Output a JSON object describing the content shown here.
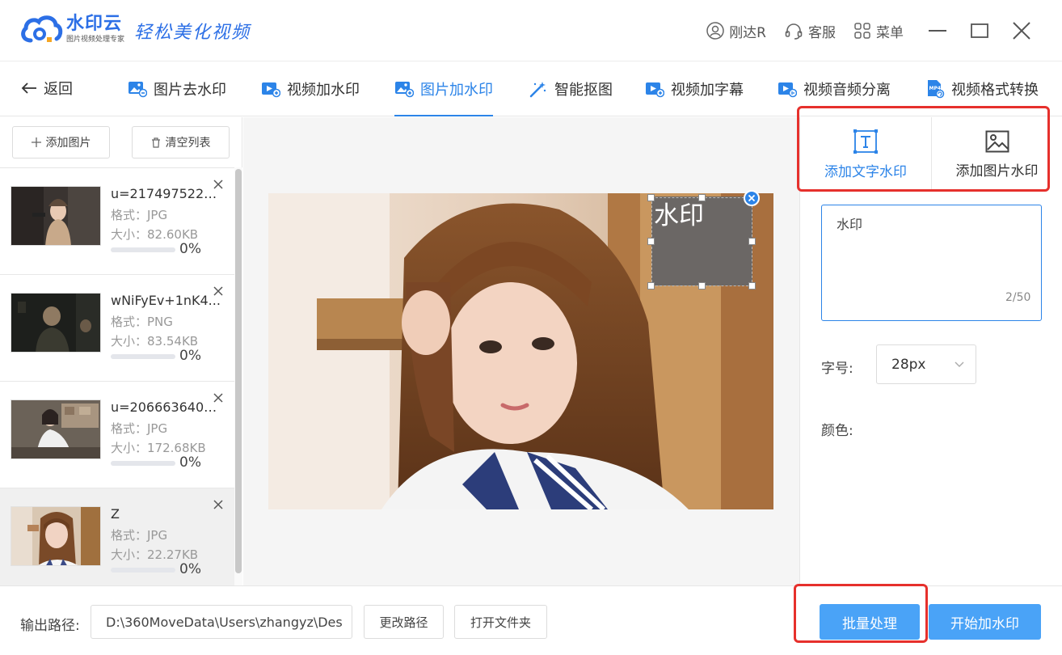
{
  "app": {
    "name": "水印云",
    "tagline": "图片视频处理专家",
    "slogan": "轻松美化视频",
    "accent_color": "#2c84e8",
    "highlight_color": "#e6302c"
  },
  "titlebar": {
    "user_label": "刚达R",
    "user_icon": "user-icon",
    "service_label": "客服",
    "service_icon": "headset-icon",
    "menu_label": "菜单",
    "menu_icon": "grid-icon",
    "window_controls": [
      "minimize-icon",
      "maximize-icon",
      "close-icon"
    ]
  },
  "toolnav": {
    "back_label": "返回",
    "tools": [
      {
        "label": "图片去水印",
        "icon": "image-remove-icon"
      },
      {
        "label": "视频加水印",
        "icon": "video-add-icon"
      },
      {
        "label": "图片加水印",
        "icon": "image-add-icon",
        "active": true
      },
      {
        "label": "智能抠图",
        "icon": "magic-wand-icon"
      },
      {
        "label": "视频加字幕",
        "icon": "video-subtitle-icon"
      },
      {
        "label": "视频音频分离",
        "icon": "video-audio-icon"
      },
      {
        "label": "视频格式转换",
        "icon": "mp4-convert-icon"
      }
    ]
  },
  "leftpanel": {
    "add_button": "添加图片",
    "clear_button": "清空列表",
    "files": [
      {
        "name": "u=2174975220,...",
        "format": "格式：JPG",
        "size": "大小：82.60KB",
        "progress_label": "0%",
        "progress": 0
      },
      {
        "name": "wNiFyEv+1nK4...",
        "format": "格式：PNG",
        "size": "大小：83.54KB",
        "progress_label": "0%",
        "progress": 0
      },
      {
        "name": "u=2066636407,...",
        "format": "格式：JPG",
        "size": "大小：172.68KB",
        "progress_label": "0%",
        "progress": 0
      },
      {
        "name": "Z",
        "format": "格式：JPG",
        "size": "大小：22.27KB",
        "progress_label": "0%",
        "progress": 0,
        "selected": true
      }
    ]
  },
  "canvas": {
    "watermark_text": "水印"
  },
  "rightpanel": {
    "tabs": [
      {
        "label": "添加文字水印",
        "icon": "text-box-icon",
        "active": true
      },
      {
        "label": "添加图片水印",
        "icon": "image-icon"
      }
    ],
    "text_value": "水印",
    "char_count": "2/50",
    "font_size_label": "字号:",
    "font_size_value": "28px",
    "color_label": "颜色:"
  },
  "footer": {
    "output_label": "输出路径:",
    "output_path": "D:\\360MoveData\\Users\\zhangyz\\Des",
    "change_path_button": "更改路径",
    "open_folder_button": "打开文件夹",
    "batch_button": "批量处理",
    "start_button": "开始加水印"
  }
}
